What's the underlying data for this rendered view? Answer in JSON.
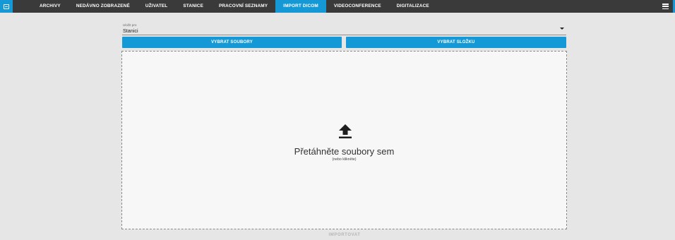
{
  "nav": {
    "tabs": [
      {
        "label": "ARCHIVY"
      },
      {
        "label": "NEDÁVNO ZOBRAZENÉ"
      },
      {
        "label": "UŽIVATEL"
      },
      {
        "label": "STANICE"
      },
      {
        "label": "PRACOVNÍ SEZNAMY"
      },
      {
        "label": "IMPORT DICOM",
        "active": true
      },
      {
        "label": "VIDEOCONFERENCE"
      },
      {
        "label": "DIGITALIZACE"
      }
    ]
  },
  "save_to": {
    "label": "Uložit pro",
    "value": "Stanici"
  },
  "buttons": {
    "select_files": "VYBRAT SOUBORY",
    "select_folder": "VYBRAT SLOŽKU"
  },
  "dropzone": {
    "title": "Přetáhněte soubory sem",
    "subtitle": "(nebo klikněte)",
    "icon": "upload-icon"
  },
  "import": {
    "label": "IMPORTOVAT",
    "enabled": false
  },
  "colors": {
    "accent": "#1599d6",
    "topbar": "#3a3a3a",
    "background": "#e6e6e6",
    "dropzone_bg": "#f7f7f7",
    "disabled_text": "#b5b5b5"
  }
}
